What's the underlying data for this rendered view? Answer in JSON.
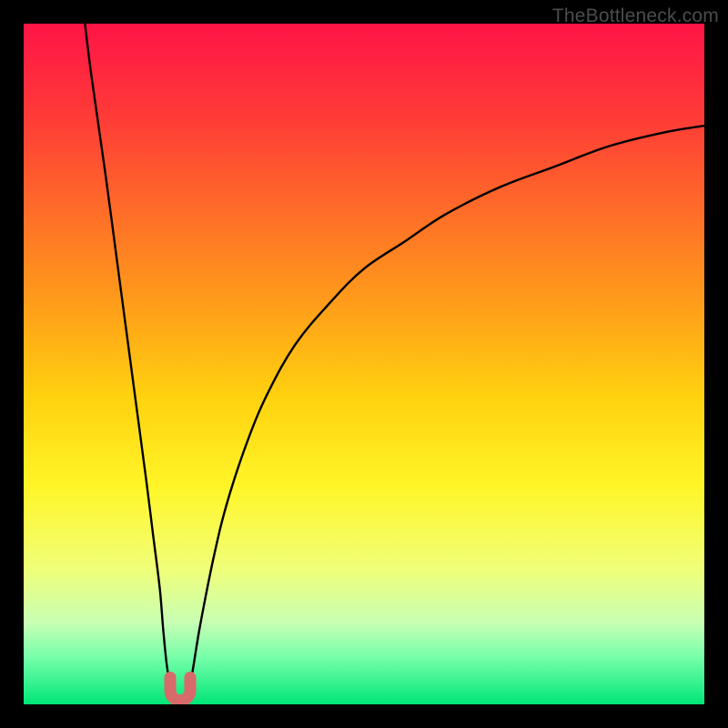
{
  "watermark": "TheBottleneck.com",
  "chart_data": {
    "type": "line",
    "title": "",
    "xlabel": "",
    "ylabel": "",
    "xlim": [
      0,
      100
    ],
    "ylim": [
      0,
      100
    ],
    "grid": false,
    "legend": false,
    "series": [
      {
        "name": "left-branch",
        "x": [
          9,
          10,
          12,
          14,
          16,
          18,
          19,
          20,
          20.5,
          21,
          21.5
        ],
        "y": [
          100,
          92,
          78,
          63,
          48,
          33,
          25,
          17,
          11,
          6,
          3
        ]
      },
      {
        "name": "valley",
        "x": [
          21.5,
          22,
          22.5,
          23,
          23.5,
          24,
          24.5
        ],
        "y": [
          3,
          1.5,
          1,
          1,
          1,
          1.5,
          3
        ]
      },
      {
        "name": "right-branch",
        "x": [
          24.5,
          25,
          26,
          28,
          30,
          33,
          36,
          40,
          45,
          50,
          56,
          62,
          70,
          78,
          86,
          94,
          100
        ],
        "y": [
          3,
          6,
          12,
          22,
          30,
          39,
          46,
          53,
          59,
          64,
          68,
          72,
          76,
          79,
          82,
          84,
          85
        ]
      }
    ],
    "marker": {
      "name": "valley-marker",
      "x": 23,
      "y": 1.5,
      "color": "#d76a6a",
      "shape": "u"
    },
    "background_gradient": {
      "top": "#ff1446",
      "bottom": "#00e678"
    }
  }
}
